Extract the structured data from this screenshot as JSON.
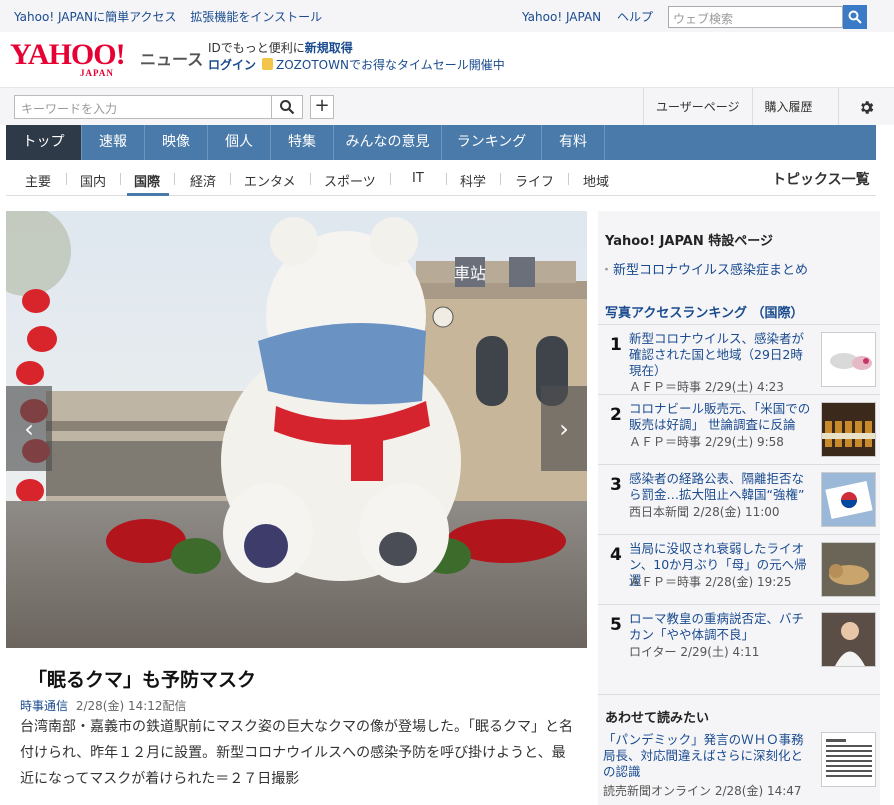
{
  "topbar": {
    "promo_1": "Yahoo! JAPANに簡単アクセス",
    "promo_2": "拡張機能をインストール",
    "link_home": "Yahoo! JAPAN",
    "link_help": "ヘルプ",
    "search_placeholder": "ウェブ検索"
  },
  "logo": {
    "brand": "YAHOO!",
    "country": "JAPAN",
    "section": "ニュース"
  },
  "login_msg": {
    "line1_prefix": "IDでもっと便利に",
    "line1_link": "新規取得",
    "login": "ログイン",
    "zozo": "ZOZOTOWNでお得なタイムセール開催中"
  },
  "searchbar": {
    "placeholder": "キーワードを入力",
    "plus": "+",
    "user_page": "ユーザーページ",
    "history": "購入履歴"
  },
  "main_nav": [
    {
      "label": "トップ",
      "active": true
    },
    {
      "label": "速報"
    },
    {
      "label": "映像"
    },
    {
      "label": "個人"
    },
    {
      "label": "特集"
    },
    {
      "label": "みんなの意見"
    },
    {
      "label": "ランキング"
    },
    {
      "label": "有料"
    }
  ],
  "sub_nav": {
    "items": [
      "主要",
      "国内",
      "国際",
      "経済",
      "エンタメ",
      "スポーツ",
      "IT",
      "科学",
      "ライフ",
      "地域"
    ],
    "active": "国際",
    "topics": "トピックス一覧"
  },
  "article": {
    "title": "「眠るクマ」も予防マスク",
    "source": "時事通信",
    "datetime": "2/28(金) 14:12配信",
    "body": "台湾南部・嘉義市の鉄道駅前にマスク姿の巨大なクマの像が登場した。「眠るクマ」と名付けられ、昨年１２月に設置。新型コロナウイルスへの感染予防を呼び掛けようと、最近になってマスクが着けられた＝２７日撮影",
    "photo_sign": "車站",
    "prev": "‹",
    "next": "›"
  },
  "sidebar": {
    "special_head": "Yahoo! JAPAN 特設ページ",
    "special_link": "新型コロナウイルス感染症まとめ",
    "ranking_head": "写真アクセスランキング （国際）",
    "ranking": [
      {
        "num": "1",
        "title": "新型コロナウイルス、感染者が確認された国と地域（29日2時現在）",
        "source": "ＡＦＰ＝時事 2/29(土) 4:23"
      },
      {
        "num": "2",
        "title": "コロナビール販売元、「米国での販売は好調」 世論調査に反論",
        "source": "ＡＦＰ＝時事 2/29(土) 9:58"
      },
      {
        "num": "3",
        "title": "感染者の経路公表、隔離拒否なら罰金…拡大阻止へ韓国“強権”",
        "source": "西日本新聞 2/28(金) 11:00"
      },
      {
        "num": "4",
        "title": "当局に没収され衰弱したライオン、10か月ぶり「母」の元へ帰還",
        "source": "ＡＦＰ＝時事 2/28(金) 19:25"
      },
      {
        "num": "5",
        "title": "ローマ教皇の重病説否定、バチカン「やや体調不良」",
        "source": "ロイター 2/29(土) 4:11"
      }
    ],
    "related_head": "あわせて読みたい",
    "related_title": "「パンデミック」発言のＷＨＯ事務局長、対応間違えばさらに深刻化との認識",
    "related_source": "読売新聞オンライン 2/28(金) 14:47"
  },
  "colors": {
    "nav_blue": "#4a7aa9",
    "nav_active": "#2f3a48",
    "brand_red": "#e60033",
    "link_blue": "#1a4b8f"
  }
}
